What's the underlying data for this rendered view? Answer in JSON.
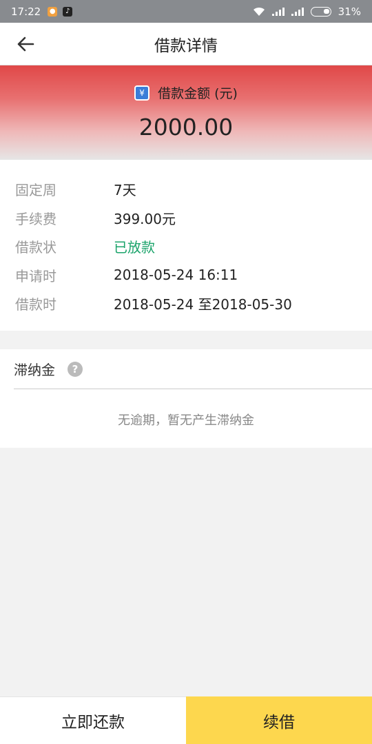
{
  "status_bar": {
    "time": "17:22",
    "battery": "31%"
  },
  "header": {
    "title": "借款详情"
  },
  "banner": {
    "label": "借款金额 (元)",
    "amount": "2000.00",
    "icon": "¥"
  },
  "details": {
    "rows": [
      {
        "key": "固定周",
        "value": "7天"
      },
      {
        "key": "手续费",
        "value": "399.00元"
      },
      {
        "key": "借款状",
        "value": "已放款"
      },
      {
        "key": "申请时",
        "value": "2018-05-24 16:11"
      },
      {
        "key": "借款时",
        "value": "2018-05-24 至2018-05-30"
      }
    ]
  },
  "late_fee": {
    "title": "滞纳金",
    "help_icon": "?",
    "note": "无逾期，暂无产生滞纳金"
  },
  "actions": {
    "repay_label": "立即还款",
    "renew_label": "续借"
  },
  "colors": {
    "status_green": "#1aa36a",
    "renew_yellow": "#fdd74e",
    "banner_red": "#e04848"
  }
}
